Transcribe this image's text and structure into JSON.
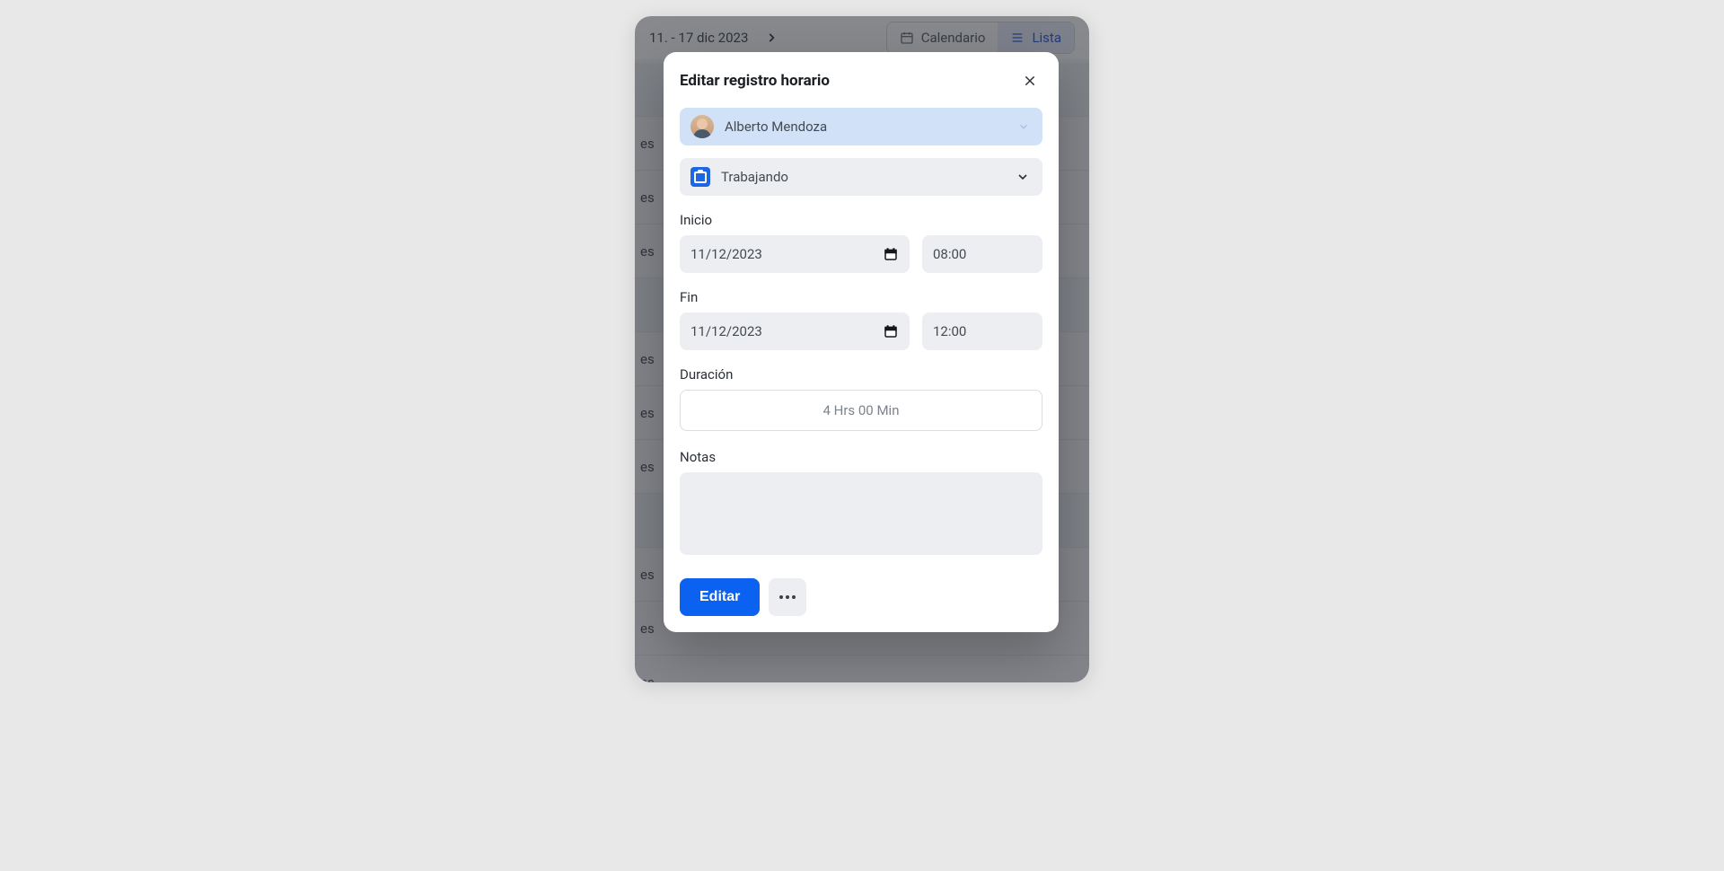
{
  "background": {
    "date_range": "11. - 17 dic 2023",
    "tabs": {
      "calendar": "Calendario",
      "list": "Lista"
    },
    "row_text": "es"
  },
  "modal": {
    "title": "Editar registro horario",
    "user": {
      "name": "Alberto Mendoza"
    },
    "status": {
      "label": "Trabajando"
    },
    "start": {
      "label": "Inicio",
      "date": "11/12/2023",
      "time": "08:00"
    },
    "end": {
      "label": "Fin",
      "date": "11/12/2023",
      "time": "12:00"
    },
    "duration": {
      "label": "Duración",
      "value": "4 Hrs 00 Min"
    },
    "notes": {
      "label": "Notas",
      "value": ""
    },
    "footer": {
      "edit": "Editar"
    }
  }
}
